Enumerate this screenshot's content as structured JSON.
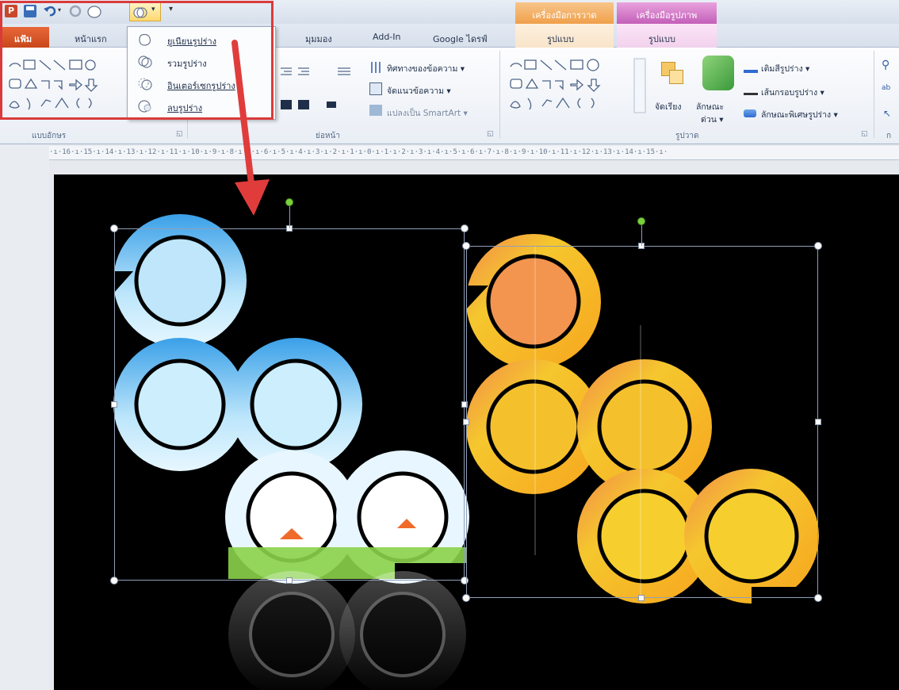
{
  "colors": {
    "accent_red": "#d93b3b",
    "file_tab": "#d8531c",
    "ctx_drawing": "#f0a04b",
    "ctx_picture": "#c35fb8",
    "slide_bg": "#000000"
  },
  "app": {
    "logo_letter": "P"
  },
  "tabs": {
    "file": "แฟ้ม",
    "home": "หน้าแรก",
    "view": "มุมมอง",
    "addin": "Add-In",
    "gdrive": "Google ไดรฟ์",
    "ctx_drawing_title": "เครื่องมือการวาด",
    "ctx_drawing_tab": "รูปแบบ",
    "ctx_picture_title": "เครื่องมือรูปภาพ",
    "ctx_picture_tab": "รูปแบบ"
  },
  "dropdown": {
    "items": [
      {
        "label": "ยูเนียนรูปร่าง",
        "icon": "union-shapes-icon"
      },
      {
        "label": "รวมรูปร่าง",
        "icon": "combine-shapes-icon"
      },
      {
        "label": "อินเตอร์เซกรูปร่าง",
        "icon": "intersect-shapes-icon"
      },
      {
        "label": "ลบรูปร่าง",
        "icon": "subtract-shapes-icon"
      }
    ]
  },
  "ribbon": {
    "groups": {
      "font": "แบบอักษร",
      "paragraph": "ย่อหน้า",
      "drawing": "รูปวาด",
      "editing": "ก"
    },
    "paragraph": {
      "text_direction": "ทิศทางของข้อความ ▾",
      "align_text": "จัดแนวข้อความ ▾",
      "smartart": "แปลงเป็น SmartArt ▾"
    },
    "drawing": {
      "arrange": "จัดเรียง",
      "quick_styles_1": "ลักษณะ",
      "quick_styles_2": "ด่วน ▾",
      "shape_fill": "เติมสีรูปร่าง ▾",
      "shape_outline": "เส้นกรอบรูปร่าง ▾",
      "shape_effects": "ลักษณะพิเศษรูปร่าง ▾"
    }
  },
  "ruler": {
    "text": "·ı·16·ı·15·ı·14·ı·13·ı·12·ı·11·ı·10·ı·9·ı·8·ı·7·ı·6·ı·5·ı·4·ı·3·ı·2·ı·1·ı·0·ı·1·ı·2·ı·3·ı·4·ı·5·ı·6·ı·7·ı·8·ı·9·ı·10·ı·11·ı·12·ı·13·ı·14·ı·15·ı·"
  }
}
